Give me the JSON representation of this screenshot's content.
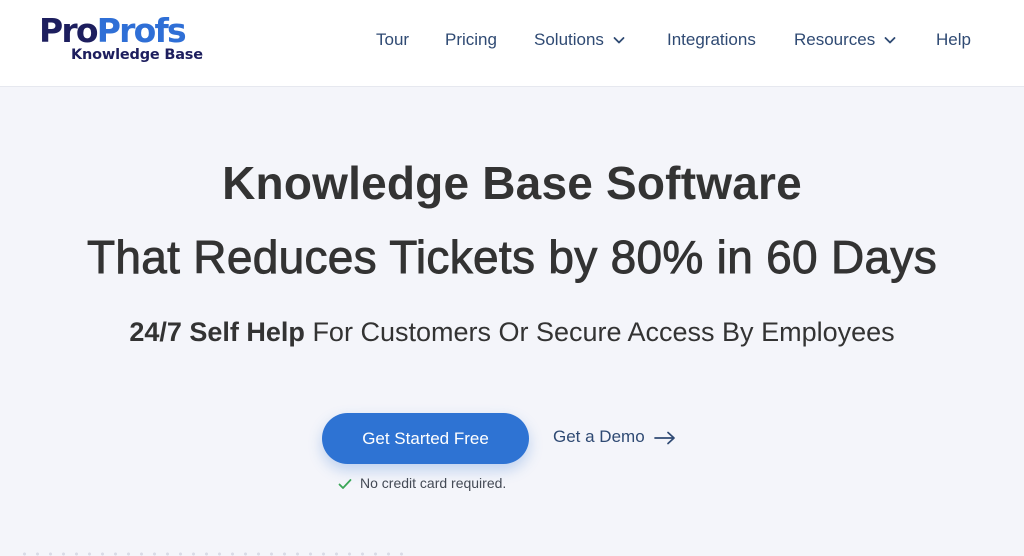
{
  "logo": {
    "brand_part1": "Pro",
    "brand_part2": "Profs",
    "product": "Knowledge Base"
  },
  "nav": {
    "items": [
      {
        "label": "Tour"
      },
      {
        "label": "Pricing"
      },
      {
        "label": "Solutions",
        "icon": "chevron-down-icon"
      },
      {
        "label": "Integrations"
      },
      {
        "label": "Resources",
        "icon": "chevron-down-icon"
      },
      {
        "label": "Help"
      }
    ]
  },
  "hero": {
    "title_line1": "Knowledge Base Software",
    "title_line2": "That Reduces Tickets by 80% in 60 Days",
    "subtitle_strong": "24/7 Self Help",
    "subtitle_rest": " For Customers Or Secure Access By Employees"
  },
  "cta": {
    "primary_label": "Get Started Free",
    "demo_label": "Get a Demo",
    "demo_icon": "arrow-right-icon",
    "note": "No credit card required.",
    "note_icon": "checkmark-icon"
  },
  "colors": {
    "brand_dark": "#1d1e5e",
    "brand_blue": "#2f6fd6",
    "button": "#2e73d3",
    "check": "#3aa657",
    "nav_text": "#2f4a73"
  }
}
